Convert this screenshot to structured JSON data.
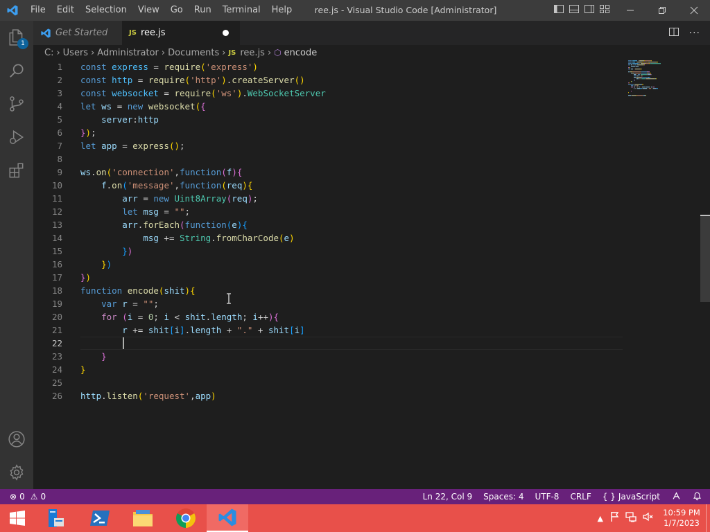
{
  "window": {
    "title": "ree.js - Visual Studio Code [Administrator]"
  },
  "menu": [
    "File",
    "Edit",
    "Selection",
    "View",
    "Go",
    "Run",
    "Terminal",
    "Help"
  ],
  "tabs": [
    {
      "label": "Get Started",
      "active": false
    },
    {
      "label": "ree.js",
      "badge": "JS",
      "active": true,
      "modified": true
    }
  ],
  "breadcrumb": [
    "C:",
    "Users",
    "Administrator",
    "Documents",
    "ree.js",
    "encode"
  ],
  "breadcrumb_badge": "JS",
  "activity": {
    "source_control_badge": "1"
  },
  "editor": {
    "current_line": 22,
    "lines": [
      [
        [
          "k",
          "const"
        ],
        [
          "p",
          " "
        ],
        [
          "c",
          "express"
        ],
        [
          "p",
          " = "
        ],
        [
          "f",
          "require"
        ],
        [
          "b1",
          "("
        ],
        [
          "s",
          "'express'"
        ],
        [
          "b1",
          ")"
        ]
      ],
      [
        [
          "k",
          "const"
        ],
        [
          "p",
          " "
        ],
        [
          "c",
          "http"
        ],
        [
          "p",
          " = "
        ],
        [
          "f",
          "require"
        ],
        [
          "b1",
          "("
        ],
        [
          "s",
          "'http'"
        ],
        [
          "b1",
          ")"
        ],
        [
          "p",
          "."
        ],
        [
          "f",
          "createServer"
        ],
        [
          "b1",
          "()"
        ]
      ],
      [
        [
          "k",
          "const"
        ],
        [
          "p",
          " "
        ],
        [
          "c",
          "websocket"
        ],
        [
          "p",
          " = "
        ],
        [
          "f",
          "require"
        ],
        [
          "b1",
          "("
        ],
        [
          "s",
          "'ws'"
        ],
        [
          "b1",
          ")"
        ],
        [
          "p",
          "."
        ],
        [
          "t",
          "WebSocketServer"
        ]
      ],
      [
        [
          "k",
          "let"
        ],
        [
          "p",
          " "
        ],
        [
          "v",
          "ws"
        ],
        [
          "p",
          " = "
        ],
        [
          "k",
          "new"
        ],
        [
          "p",
          " "
        ],
        [
          "f",
          "websocket"
        ],
        [
          "b1",
          "("
        ],
        [
          "b2",
          "{"
        ]
      ],
      [
        [
          "p",
          "    "
        ],
        [
          "v",
          "server"
        ],
        [
          "p",
          ":"
        ],
        [
          "v",
          "http"
        ]
      ],
      [
        [
          "b2",
          "}"
        ],
        [
          "b1",
          ")"
        ],
        [
          "p",
          ";"
        ]
      ],
      [
        [
          "k",
          "let"
        ],
        [
          "p",
          " "
        ],
        [
          "v",
          "app"
        ],
        [
          "p",
          " = "
        ],
        [
          "f",
          "express"
        ],
        [
          "b1",
          "()"
        ],
        [
          "p",
          ";"
        ]
      ],
      [],
      [
        [
          "v",
          "ws"
        ],
        [
          "p",
          "."
        ],
        [
          "f",
          "on"
        ],
        [
          "b1",
          "("
        ],
        [
          "s",
          "'connection'"
        ],
        [
          "p",
          ","
        ],
        [
          "k",
          "function"
        ],
        [
          "b2",
          "("
        ],
        [
          "v",
          "f"
        ],
        [
          "b2",
          ")"
        ],
        [
          "b2",
          "{"
        ]
      ],
      [
        [
          "p",
          "    "
        ],
        [
          "v",
          "f"
        ],
        [
          "p",
          "."
        ],
        [
          "f",
          "on"
        ],
        [
          "b3",
          "("
        ],
        [
          "s",
          "'message'"
        ],
        [
          "p",
          ","
        ],
        [
          "k",
          "function"
        ],
        [
          "b1",
          "("
        ],
        [
          "v",
          "req"
        ],
        [
          "b1",
          ")"
        ],
        [
          "b1",
          "{"
        ]
      ],
      [
        [
          "p",
          "        "
        ],
        [
          "v",
          "arr"
        ],
        [
          "p",
          " = "
        ],
        [
          "k",
          "new"
        ],
        [
          "p",
          " "
        ],
        [
          "t",
          "Uint8Array"
        ],
        [
          "b2",
          "("
        ],
        [
          "v",
          "req"
        ],
        [
          "b2",
          ")"
        ],
        [
          "p",
          ";"
        ]
      ],
      [
        [
          "p",
          "        "
        ],
        [
          "k",
          "let"
        ],
        [
          "p",
          " "
        ],
        [
          "v",
          "msg"
        ],
        [
          "p",
          " = "
        ],
        [
          "s",
          "\"\""
        ],
        [
          "p",
          ";"
        ]
      ],
      [
        [
          "p",
          "        "
        ],
        [
          "v",
          "arr"
        ],
        [
          "p",
          "."
        ],
        [
          "f",
          "forEach"
        ],
        [
          "b2",
          "("
        ],
        [
          "k",
          "function"
        ],
        [
          "b3",
          "("
        ],
        [
          "v",
          "e"
        ],
        [
          "b3",
          ")"
        ],
        [
          "b3",
          "{"
        ]
      ],
      [
        [
          "p",
          "            "
        ],
        [
          "v",
          "msg"
        ],
        [
          "p",
          " += "
        ],
        [
          "t",
          "String"
        ],
        [
          "p",
          "."
        ],
        [
          "f",
          "fromCharCode"
        ],
        [
          "b1",
          "("
        ],
        [
          "v",
          "e"
        ],
        [
          "b1",
          ")"
        ]
      ],
      [
        [
          "p",
          "        "
        ],
        [
          "b3",
          "}"
        ],
        [
          "b2",
          ")"
        ]
      ],
      [
        [
          "p",
          "    "
        ],
        [
          "b1",
          "}"
        ],
        [
          "b3",
          ")"
        ]
      ],
      [
        [
          "b2",
          "}"
        ],
        [
          "b1",
          ")"
        ]
      ],
      [
        [
          "k",
          "function"
        ],
        [
          "p",
          " "
        ],
        [
          "f",
          "encode"
        ],
        [
          "b1",
          "("
        ],
        [
          "v",
          "shit"
        ],
        [
          "b1",
          ")"
        ],
        [
          "b1",
          "{"
        ]
      ],
      [
        [
          "p",
          "    "
        ],
        [
          "k",
          "var"
        ],
        [
          "p",
          " "
        ],
        [
          "v",
          "r"
        ],
        [
          "p",
          " = "
        ],
        [
          "s",
          "\"\""
        ],
        [
          "p",
          ";"
        ]
      ],
      [
        [
          "p",
          "    "
        ],
        [
          "ck",
          "for"
        ],
        [
          "p",
          " "
        ],
        [
          "b2",
          "("
        ],
        [
          "v",
          "i"
        ],
        [
          "p",
          " = "
        ],
        [
          "n",
          "0"
        ],
        [
          "p",
          "; "
        ],
        [
          "v",
          "i"
        ],
        [
          "p",
          " < "
        ],
        [
          "v",
          "shit"
        ],
        [
          "p",
          "."
        ],
        [
          "v",
          "length"
        ],
        [
          "p",
          "; "
        ],
        [
          "v",
          "i"
        ],
        [
          "p",
          "++"
        ],
        [
          "b2",
          ")"
        ],
        [
          "b2",
          "{"
        ]
      ],
      [
        [
          "p",
          "        "
        ],
        [
          "v",
          "r"
        ],
        [
          "p",
          " += "
        ],
        [
          "v",
          "shit"
        ],
        [
          "b3",
          "["
        ],
        [
          "v",
          "i"
        ],
        [
          "b3",
          "]"
        ],
        [
          "p",
          "."
        ],
        [
          "v",
          "length"
        ],
        [
          "p",
          " + "
        ],
        [
          "s",
          "\".\""
        ],
        [
          "p",
          " + "
        ],
        [
          "v",
          "shit"
        ],
        [
          "b3",
          "["
        ],
        [
          "v",
          "i"
        ],
        [
          "b3",
          "]"
        ]
      ],
      [],
      [
        [
          "p",
          "    "
        ],
        [
          "b2",
          "}"
        ]
      ],
      [
        [
          "b1",
          "}"
        ]
      ],
      [],
      [
        [
          "v",
          "http"
        ],
        [
          "p",
          "."
        ],
        [
          "f",
          "listen"
        ],
        [
          "b1",
          "("
        ],
        [
          "s",
          "'request'"
        ],
        [
          "p",
          ","
        ],
        [
          "v",
          "app"
        ],
        [
          "b1",
          ")"
        ]
      ]
    ]
  },
  "status": {
    "errors": "0",
    "warnings": "0",
    "position": "Ln 22, Col 9",
    "spaces": "Spaces: 4",
    "encoding": "UTF-8",
    "eol": "CRLF",
    "language": "JavaScript",
    "language_icon": "{ }"
  },
  "taskbar": {
    "time": "10:59 PM",
    "date": "1/7/2023",
    "apps": [
      "start-button",
      "server-manager",
      "powershell",
      "file-explorer",
      "chrome",
      "vscode"
    ]
  },
  "colors": {
    "statusbar": "#68217a",
    "taskbar": "#e8504a",
    "titlebar": "#3c3c3c"
  }
}
